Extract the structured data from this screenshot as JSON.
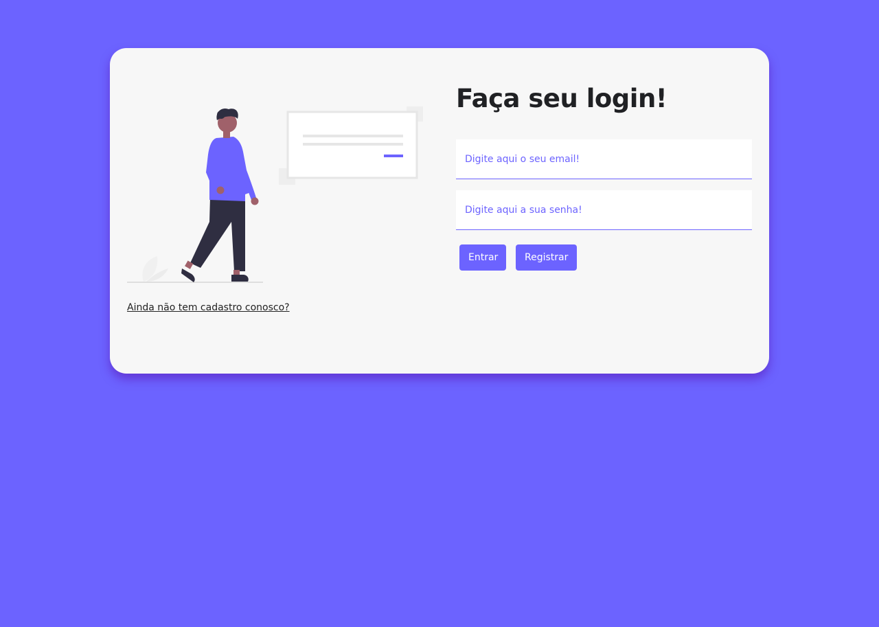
{
  "login": {
    "title": "Faça seu login!",
    "email_placeholder": "Digite aqui o seu email!",
    "password_placeholder": "Digite aqui a sua senha!",
    "login_button": "Entrar",
    "register_button": "Registrar"
  },
  "signup_link": "Ainda não tem cadastro conosco?",
  "colors": {
    "background": "#6c63ff",
    "card": "#f7f7f7",
    "accent": "#6c63ff"
  }
}
